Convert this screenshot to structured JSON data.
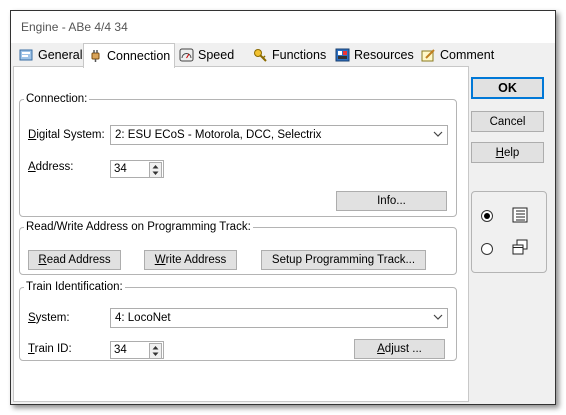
{
  "window": {
    "title": "Engine - ABe 4/4 34"
  },
  "tabs": [
    {
      "label": "General",
      "icon": "general-icon"
    },
    {
      "label": "Connection",
      "icon": "connection-plug-icon",
      "active": true
    },
    {
      "label": "Speed",
      "icon": "speedometer-icon"
    },
    {
      "label": "Functions",
      "icon": "functions-key-icon"
    },
    {
      "label": "Resources",
      "icon": "resources-icon"
    },
    {
      "label": "Comment",
      "icon": "comment-pencil-icon"
    }
  ],
  "connection": {
    "group_label": "Connection:",
    "digital_system": {
      "label_u": "D",
      "label_rest": "igital System:",
      "value": "2: ESU ECoS - Motorola, DCC, Selectrix"
    },
    "address": {
      "label_u": "A",
      "label_rest": "ddress:",
      "value": "34"
    },
    "info_button": "Info..."
  },
  "programming": {
    "group_label": "Read/Write Address on Programming Track:",
    "read": {
      "u": "R",
      "rest": "ead Address"
    },
    "write": {
      "u": "W",
      "rest": "rite Address"
    },
    "setup": {
      "text": "Setup Programming Track..."
    }
  },
  "train_id": {
    "group_label": "Train Identification:",
    "system": {
      "label_u": "S",
      "label_rest": "ystem:",
      "value": "4: LocoNet"
    },
    "train": {
      "label_u": "T",
      "label_rest": "rain ID:",
      "value": "34"
    },
    "adjust": {
      "u": "A",
      "rest": "djust ..."
    }
  },
  "buttons": {
    "ok": "OK",
    "cancel": "Cancel",
    "help": {
      "u": "H",
      "rest": "elp"
    }
  },
  "view_options": [
    {
      "checked": true,
      "icon": "single-list-view-icon"
    },
    {
      "checked": false,
      "icon": "multi-window-view-icon"
    }
  ],
  "colors": {
    "accent": "#0078d7",
    "background": "#f0f0f0"
  }
}
